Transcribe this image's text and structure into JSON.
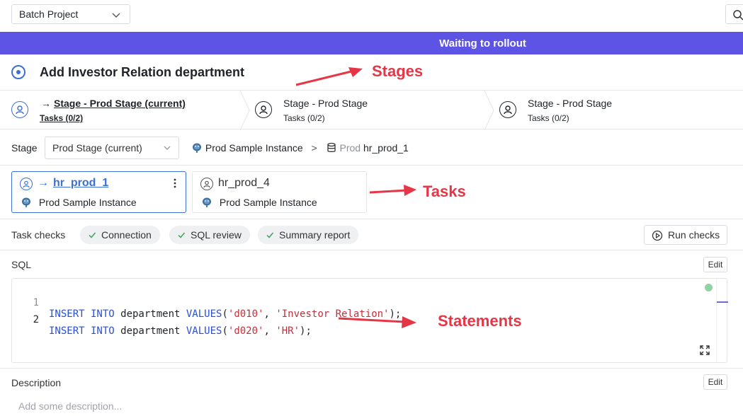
{
  "header": {
    "project_select": "Batch Project"
  },
  "banner": {
    "text": "Waiting to rollout"
  },
  "issue": {
    "title": "Add Investor Relation department"
  },
  "annotations": {
    "stages": "Stages",
    "tasks": "Tasks",
    "statements": "Statements"
  },
  "stages": [
    {
      "arrow": "→",
      "name": "Stage - Prod Stage (current)",
      "tasks": "Tasks (0/2)",
      "current": true
    },
    {
      "name": "Stage - Prod Stage",
      "tasks": "Tasks (0/2)",
      "current": false
    },
    {
      "name": "Stage - Prod Stage",
      "tasks": "Tasks (0/2)",
      "current": false
    }
  ],
  "stage_row": {
    "label": "Stage",
    "selected": "Prod Stage (current)",
    "instance": "Prod Sample Instance",
    "separator": ">",
    "db_env": "Prod",
    "db_name": "hr_prod_1"
  },
  "tasks": [
    {
      "arrow": "→",
      "name": "hr_prod_1",
      "instance": "Prod Sample Instance",
      "active": true
    },
    {
      "name": "hr_prod_4",
      "instance": "Prod Sample Instance",
      "active": false
    }
  ],
  "task_checks": {
    "label": "Task checks",
    "chips": [
      "Connection",
      "SQL review",
      "Summary report"
    ],
    "run_button": "Run checks"
  },
  "sql": {
    "label": "SQL",
    "edit": "Edit",
    "lines": [
      {
        "n": "1",
        "kw1": "INSERT INTO",
        "t1": " department ",
        "kw2": "VALUES",
        "t2": "(",
        "s1": "'d010'",
        "t3": ", ",
        "s2": "'Investor Relation'",
        "t4": ");"
      },
      {
        "n": "2",
        "kw1": "INSERT INTO",
        "t1": " department ",
        "kw2": "VALUES",
        "t2": "(",
        "s1": "'d020'",
        "t3": ", ",
        "s2": "'HR'",
        "t4": ");"
      }
    ]
  },
  "description": {
    "label": "Description",
    "edit": "Edit",
    "placeholder": "Add some description..."
  },
  "colors": {
    "banner": "#5d54e6",
    "accent": "#3b6fd4",
    "annotation": "#e53647",
    "keyword": "#2a4fd6",
    "string": "#c2303a"
  }
}
